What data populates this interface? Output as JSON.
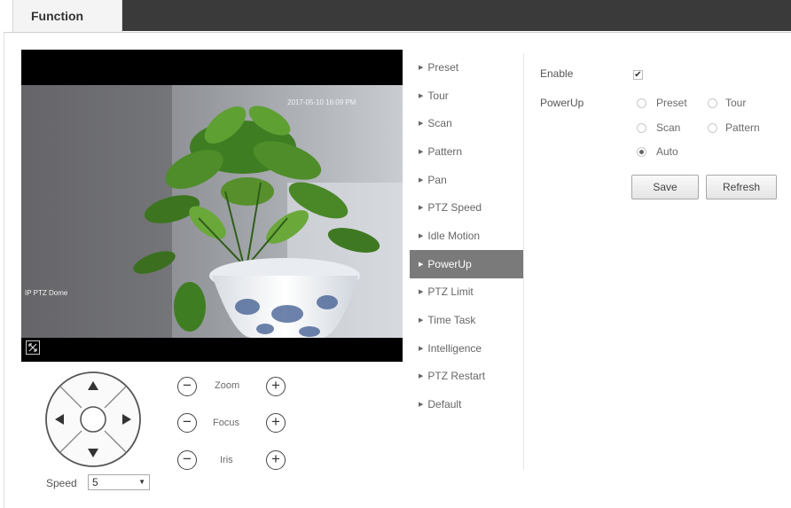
{
  "header": {
    "tab_label": "Function"
  },
  "video": {
    "timestamp": "2017-05-10 16:09 PM",
    "channel_name": "IP PTZ Dome"
  },
  "ptz_control": {
    "zoom_label": "Zoom",
    "focus_label": "Focus",
    "iris_label": "Iris",
    "minus_symbol": "−",
    "plus_symbol": "+",
    "speed_label": "Speed",
    "speed_value": "5"
  },
  "menu": {
    "items": [
      "Preset",
      "Tour",
      "Scan",
      "Pattern",
      "Pan",
      "PTZ Speed",
      "Idle Motion",
      "PowerUp",
      "PTZ Limit",
      "Time Task",
      "Intelligence",
      "PTZ Restart",
      "Default"
    ],
    "active": "PowerUp"
  },
  "config": {
    "enable_label": "Enable",
    "enable_checked": true,
    "powerup_label": "PowerUp",
    "options": [
      "Preset",
      "Tour",
      "Scan",
      "Pattern",
      "Auto"
    ],
    "selected_option": "Auto",
    "save_label": "Save",
    "refresh_label": "Refresh"
  }
}
